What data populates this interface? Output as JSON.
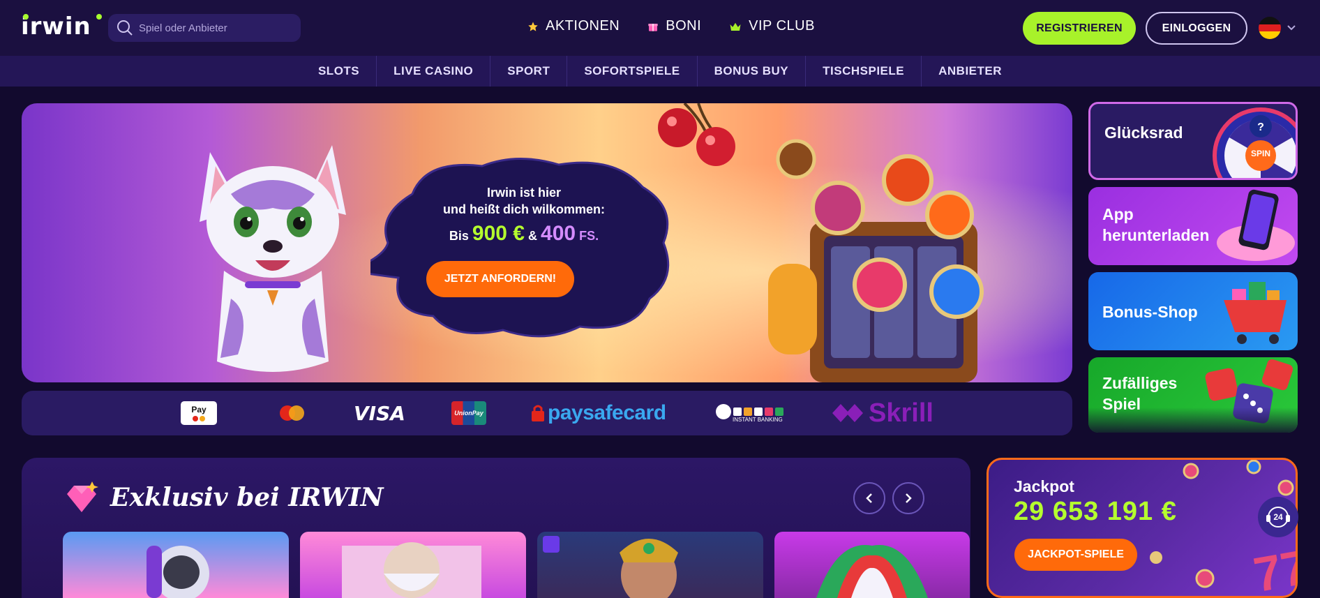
{
  "brand": {
    "logo_text": "irwin",
    "accent": "#a8f22a",
    "bg": "#120a2e"
  },
  "search": {
    "placeholder": "Spiel oder Anbieter"
  },
  "topnav": [
    {
      "label": "AKTIONEN",
      "icon": "star-icon"
    },
    {
      "label": "BONI",
      "icon": "gift-icon"
    },
    {
      "label": "VIP CLUB",
      "icon": "crown-icon"
    }
  ],
  "auth": {
    "register_label": "REGISTRIEREN",
    "login_label": "EINLOGGEN"
  },
  "language": {
    "icon": "germany-flag-icon"
  },
  "subnav": [
    "SLOTS",
    "LIVE CASINO",
    "SPORT",
    "SOFORTSPIELE",
    "BONUS BUY",
    "TISCHSPIELE",
    "ANBIETER"
  ],
  "hero": {
    "line1": "Irwin ist hier",
    "line2": "und heißt dich wilkommen:",
    "prefix": "Bis",
    "amount": "900 €",
    "amp": "&",
    "spins": "400",
    "spins_unit": "FS.",
    "cta": "JETZT ANFORDERN!"
  },
  "payments": {
    "applepay": "Pay",
    "visa": "VISA",
    "unionpay": "UnionPay",
    "paysafe": "paysafecard",
    "instant": "INSTANT BANKING",
    "skrill": "Skrill"
  },
  "side_cards": [
    {
      "title": "Glücksrad",
      "badge": "SPIN",
      "color": "#2a1b63"
    },
    {
      "title": "App herunterladen",
      "color": "#a83ae8"
    },
    {
      "title": "Bonus-Shop",
      "color": "#1b7cf0"
    },
    {
      "title": "Zufälliges Spiel",
      "color": "#1fa12b"
    }
  ],
  "exclusive": {
    "title": "Exklusiv bei IRWIN"
  },
  "jackpot": {
    "label": "Jackpot",
    "amount": "29 653 191 €",
    "cta": "JACKPOT-SPIELE"
  },
  "support": {
    "label": "24"
  }
}
